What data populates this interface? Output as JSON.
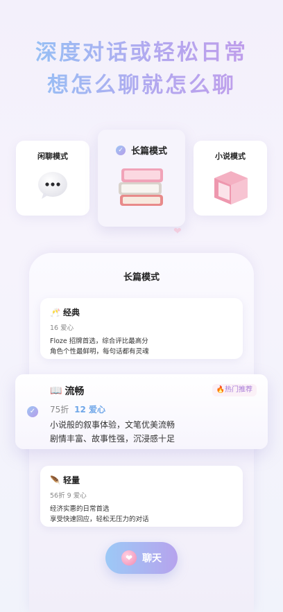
{
  "headline": {
    "line1": "深度对话或轻松日常",
    "line2": "想怎么聊就怎么聊"
  },
  "modes": [
    {
      "title": "闲聊模式",
      "icon": "chat-bubble-icon",
      "selected": false
    },
    {
      "title": "长篇模式",
      "icon": "stacked-books-icon",
      "selected": true
    },
    {
      "title": "小说模式",
      "icon": "pink-book-icon",
      "selected": false
    }
  ],
  "panel": {
    "title": "长篇模式"
  },
  "tiers": {
    "classic": {
      "emoji": "🥂",
      "name": "经典",
      "price": "16 爱心",
      "desc1": "Floze 招牌首选，综合评比最高分",
      "desc2": "角色个性最鲜明，每句话都有灵魂"
    },
    "smooth": {
      "emoji": "📖",
      "name": "流畅",
      "discount": "75折",
      "price": "12 爱心",
      "badge": "🔥热门推荐",
      "desc1": "小说般的叙事体验，文笔优美流畅",
      "desc2": "剧情丰富、故事性强，沉浸感十足",
      "selected": true
    },
    "light": {
      "emoji": "🪶",
      "name": "轻量",
      "discount": "56折",
      "price": "9 爱心",
      "desc1": "经济实惠的日常首选",
      "desc2": "享受快速回应，轻松无压力的对话"
    }
  },
  "chat_button": {
    "label": "聊天",
    "icon": "heart-icon"
  },
  "colors": {
    "gradient_start": "#8ec6f6",
    "gradient_end": "#c49ae9",
    "price_accent": "#6ea6e8",
    "badge_text": "#a97cd8"
  }
}
